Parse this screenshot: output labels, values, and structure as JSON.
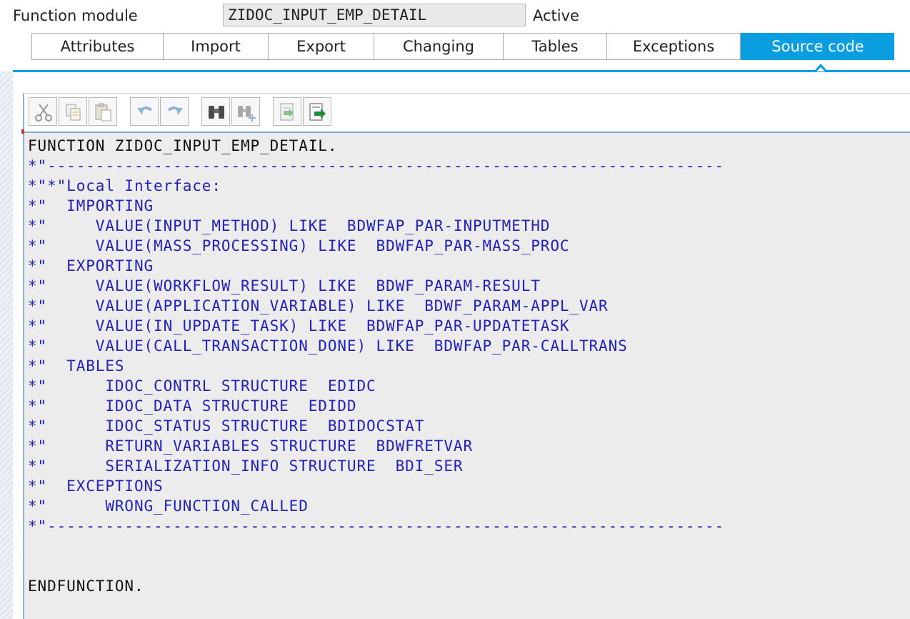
{
  "header": {
    "function_module_label": "Function module",
    "function_module_name": "ZIDOC_INPUT_EMP_DETAIL",
    "status": "Active"
  },
  "tabs": [
    {
      "label": "Attributes",
      "active": false
    },
    {
      "label": "Import",
      "active": false
    },
    {
      "label": "Export",
      "active": false
    },
    {
      "label": "Changing",
      "active": false
    },
    {
      "label": "Tables",
      "active": false
    },
    {
      "label": "Exceptions",
      "active": false
    },
    {
      "label": "Source code",
      "active": true
    }
  ],
  "toolbar": {
    "buttons": [
      "cut-icon",
      "copy-icon",
      "paste-icon",
      "undo-icon",
      "redo-icon",
      "find-icon",
      "find-next-icon",
      "insert-pattern-icon",
      "pretty-printer-icon"
    ]
  },
  "colors": {
    "accent": "#0a9ee0",
    "comment": "#2222bb",
    "code_background": "#ececec"
  },
  "source": {
    "lines": [
      "FUNCTION ZIDOC_INPUT_EMP_DETAIL.",
      "*\"----------------------------------------------------------------------",
      "*\"*\"Local Interface:",
      "*\"  IMPORTING",
      "*\"     VALUE(INPUT_METHOD) LIKE  BDWFAP_PAR-INPUTMETHD",
      "*\"     VALUE(MASS_PROCESSING) LIKE  BDWFAP_PAR-MASS_PROC",
      "*\"  EXPORTING",
      "*\"     VALUE(WORKFLOW_RESULT) LIKE  BDWF_PARAM-RESULT",
      "*\"     VALUE(APPLICATION_VARIABLE) LIKE  BDWF_PARAM-APPL_VAR",
      "*\"     VALUE(IN_UPDATE_TASK) LIKE  BDWFAP_PAR-UPDATETASK",
      "*\"     VALUE(CALL_TRANSACTION_DONE) LIKE  BDWFAP_PAR-CALLTRANS",
      "*\"  TABLES",
      "*\"      IDOC_CONTRL STRUCTURE  EDIDC",
      "*\"      IDOC_DATA STRUCTURE  EDIDD",
      "*\"      IDOC_STATUS STRUCTURE  BDIDOCSTAT",
      "*\"      RETURN_VARIABLES STRUCTURE  BDWFRETVAR",
      "*\"      SERIALIZATION_INFO STRUCTURE  BDI_SER",
      "*\"  EXCEPTIONS",
      "*\"      WRONG_FUNCTION_CALLED",
      "*\"----------------------------------------------------------------------",
      "",
      "",
      "",
      "ENDFUNCTION."
    ]
  }
}
